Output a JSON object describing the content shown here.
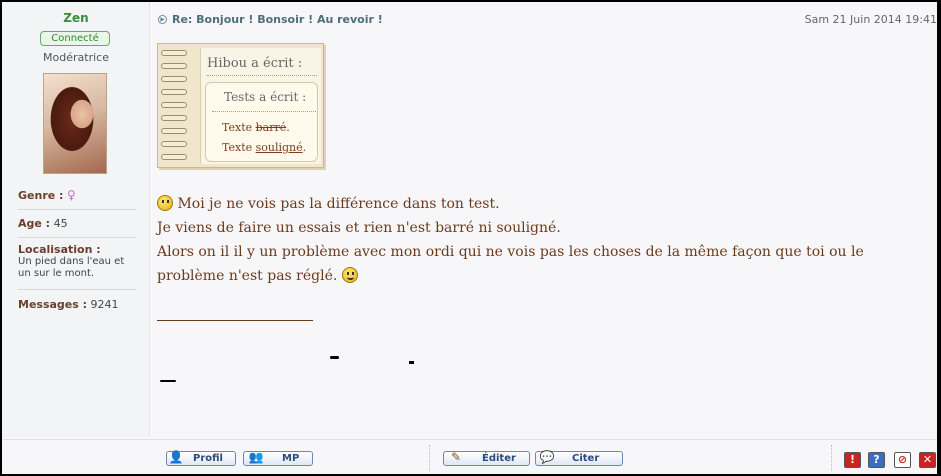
{
  "profile": {
    "username": "Zen",
    "status": "Connecté",
    "rank": "Modératrice",
    "fields": [
      {
        "key": "Genre :",
        "value": ""
      },
      {
        "key": "Age :",
        "value": "45"
      },
      {
        "key": "Localisation :",
        "value": "Un pied dans l'eau et un sur le mont."
      },
      {
        "key": "Messages :",
        "value": "9241"
      }
    ]
  },
  "post": {
    "subject": "Re: Bonjour ! Bonsoir ! Au revoir !",
    "date": "Sam 21 Juin 2014 19:41",
    "quote_outer_author": "Hibou a écrit :",
    "quote_inner_author": "Tests a écrit :",
    "quote_line1_prefix": "Texte ",
    "quote_line1_effect": "barré",
    "quote_line1_suffix": ".",
    "quote_line2_prefix": "Texte ",
    "quote_line2_effect": "souligné",
    "quote_line2_suffix": ".",
    "message_lines": [
      "Moi je ne vois pas la différence dans ton test.",
      "Je viens de faire un essais et rien n'est barré ni souligné.",
      "Alors on il il y un problème avec mon ordi qui ne vois pas les choses de la même façon que toi ou le",
      "problème n'est pas réglé."
    ]
  },
  "footer": {
    "profile_label": "Profil",
    "pm_label": "MP",
    "edit_label": "Éditer",
    "quote_label": "Citer",
    "report_label": "!",
    "help_label": "?"
  },
  "colors": {
    "username": "#3a8c3a",
    "text": "#6b3a1c",
    "subject": "#4d6f7a",
    "report": "#cc2222",
    "help": "#3a6fc0",
    "block": "#cc2222",
    "delete": "#cc2222"
  }
}
